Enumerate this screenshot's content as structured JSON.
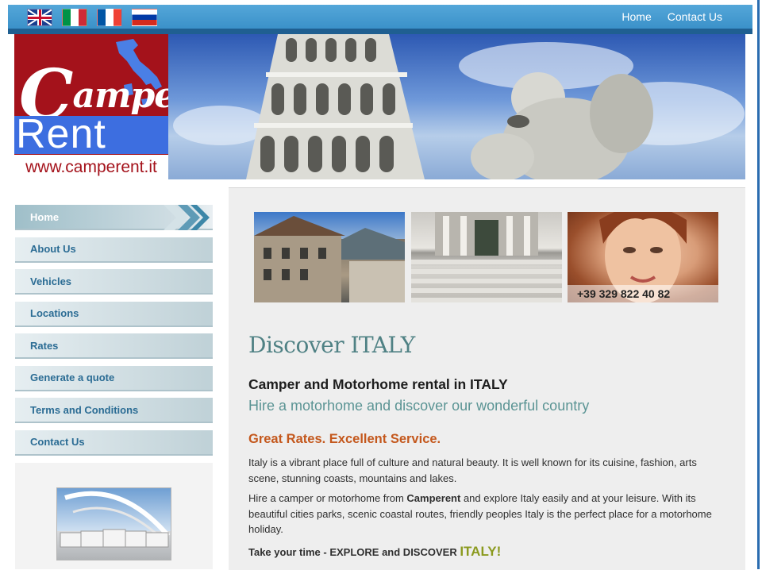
{
  "topbar": {
    "flags": [
      "UK",
      "Italy",
      "France",
      "Russia"
    ],
    "nav": [
      "Home",
      "Contact Us"
    ]
  },
  "header": {
    "logo_line1": "Camper",
    "logo_line2": "Rent",
    "logo_url": "www.camperent.it"
  },
  "sidebar": {
    "items": [
      "Home",
      "About Us",
      "Vehicles",
      "Locations",
      "Rates",
      "Generate a quote",
      "Terms and Conditions",
      "Contact Us"
    ],
    "active_index": 0
  },
  "main": {
    "phone": "+39 329 822 40 82",
    "title": "Discover ITALY",
    "subtitle1": "Camper and Motorhome rental in ITALY",
    "subtitle2": "Hire a motorhome and discover our wonderful country",
    "rates_heading": "Great Rates. Excellent Service.",
    "para1": "Italy is a vibrant place full of culture and natural beauty. It is well known for its cuisine, fashion, arts scene, stunning coasts, mountains and lakes.",
    "para2_pre": "Hire a camper or motorhome from ",
    "para2_brand": "Camperent",
    "para2_post": " and explore Italy easily and at your leisure. With its beautiful cities parks, scenic coastal routes, friendly peoples Italy is the perfect place for a motorhome holiday.",
    "tagline_pre": "Take your time - EXPLORE and DISCOVER ",
    "tagline_italy": "ITALY!"
  },
  "colors": {
    "topbar": "#3b91c9",
    "topbar_dark": "#1f5f91",
    "logo_red": "#a4121b",
    "logo_blue": "#3d6ee0",
    "menu_text": "#2b6c94",
    "title_teal": "#4f8184",
    "rates_orange": "#c4581d",
    "italy_olive": "#8b9a1f"
  }
}
